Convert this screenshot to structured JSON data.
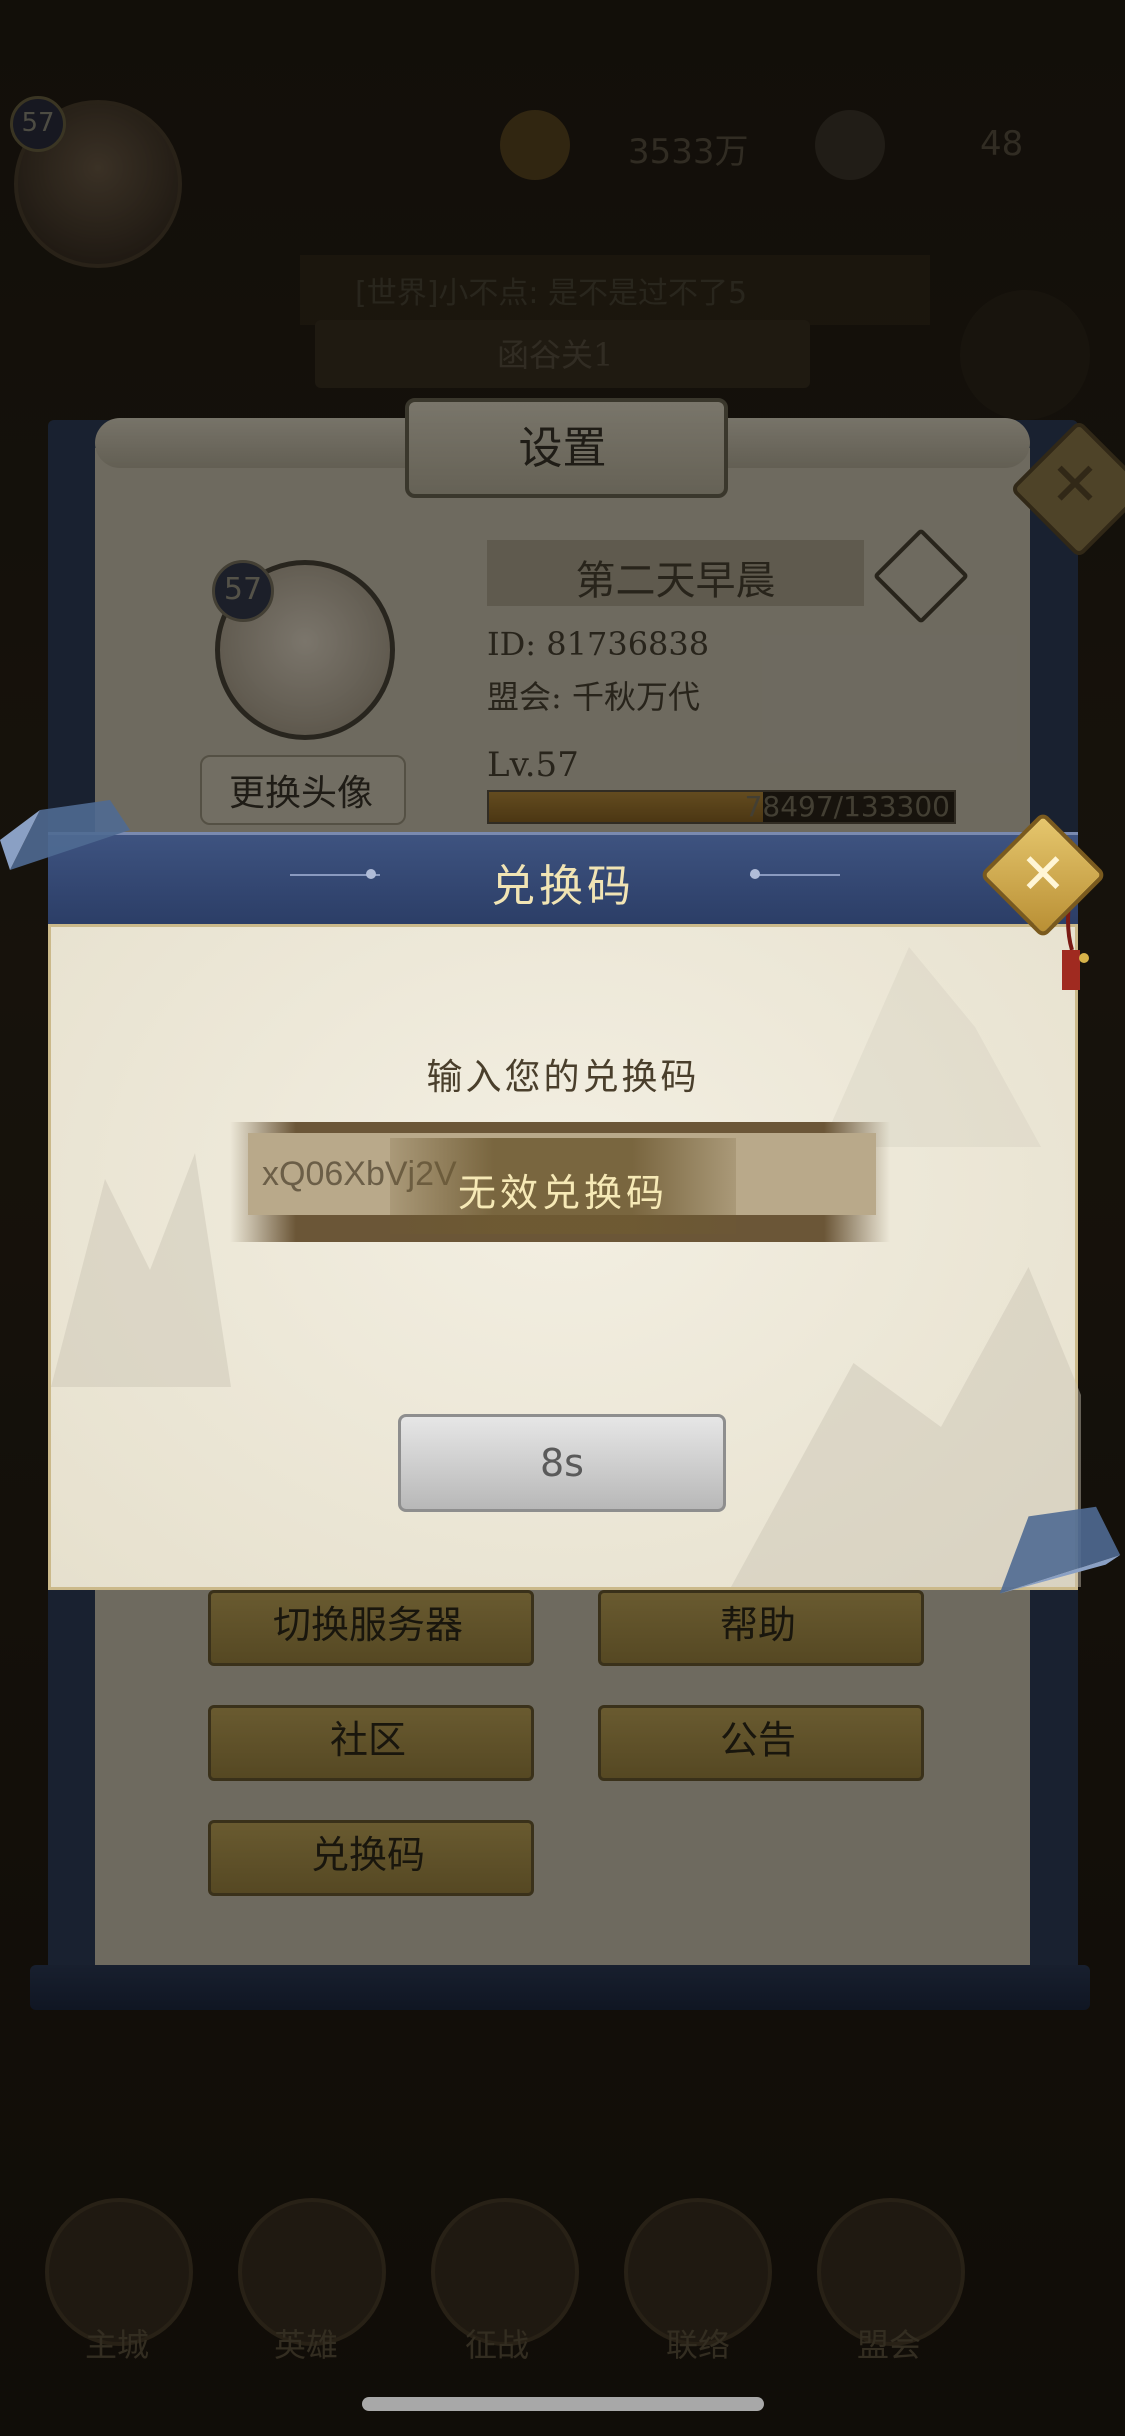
{
  "background": {
    "player_level": "57",
    "currency_1": "3533万",
    "currency_2": "48",
    "chat_message": "[世界]小不点: 是不是过不了5",
    "stage_name": "函谷关1",
    "nav": [
      "主城",
      "英雄",
      "征战",
      "联络",
      "盟会"
    ]
  },
  "settings": {
    "title": "设置",
    "avatar_level": "57",
    "change_avatar_label": "更换头像",
    "player_name": "第二天早晨",
    "player_id": "ID: 81736838",
    "guild": "盟会: 千秋万代",
    "level_label": "Lv.57",
    "xp_text": "78497/133300",
    "xp_fraction": 0.589,
    "buttons": {
      "switch_server": "切换服务器",
      "help": "帮助",
      "community": "社区",
      "announcement": "公告",
      "redeem_code": "兑换码"
    }
  },
  "redeem_dialog": {
    "title": "兑换码",
    "prompt": "输入您的兑换码",
    "input_value": "xQ06XbVj2V",
    "toast": "无效兑换码",
    "countdown_label": "8s"
  },
  "colors": {
    "dialog_header": "#33477a",
    "accent_gold": "#c9a24a",
    "toast_text": "#f6e9b6"
  }
}
